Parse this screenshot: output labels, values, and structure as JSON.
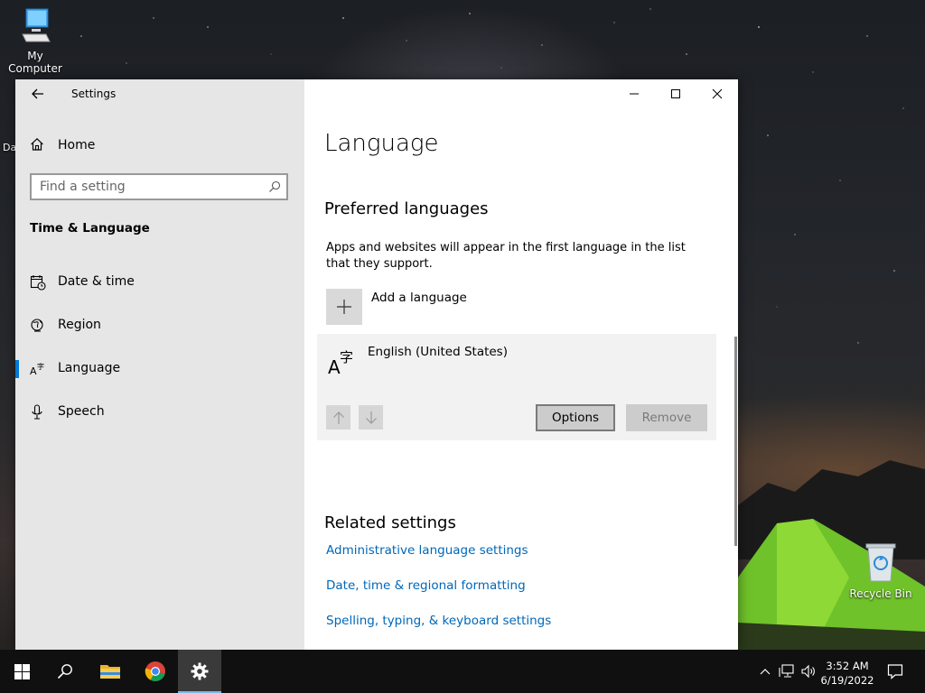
{
  "desktop": {
    "my_computer_label": "My Computer",
    "recycle_bin_label": "Recycle Bin",
    "partial_label": "Da"
  },
  "window": {
    "title": "Settings",
    "sidebar": {
      "home_label": "Home",
      "search_placeholder": "Find a setting",
      "section_title": "Time & Language",
      "items": [
        {
          "label": "Date & time",
          "icon": "calendar-clock-icon"
        },
        {
          "label": "Region",
          "icon": "globe-icon"
        },
        {
          "label": "Language",
          "icon": "language-icon",
          "active": true
        },
        {
          "label": "Speech",
          "icon": "microphone-icon"
        }
      ]
    },
    "content": {
      "page_title": "Language",
      "preferred_heading": "Preferred languages",
      "preferred_description": "Apps and websites will appear in the first language in the list that they support.",
      "add_language_label": "Add a language",
      "language_entry": "English (United States)",
      "options_label": "Options",
      "remove_label": "Remove",
      "related_heading": "Related settings",
      "related_links": [
        "Administrative language settings",
        "Date, time & regional formatting",
        "Spelling, typing, & keyboard settings"
      ]
    }
  },
  "taskbar": {
    "time": "3:52 AM",
    "date": "6/19/2022"
  },
  "colors": {
    "accent": "#0078d7",
    "link": "#0067b8",
    "sidebar_bg": "#e6e6e6"
  }
}
